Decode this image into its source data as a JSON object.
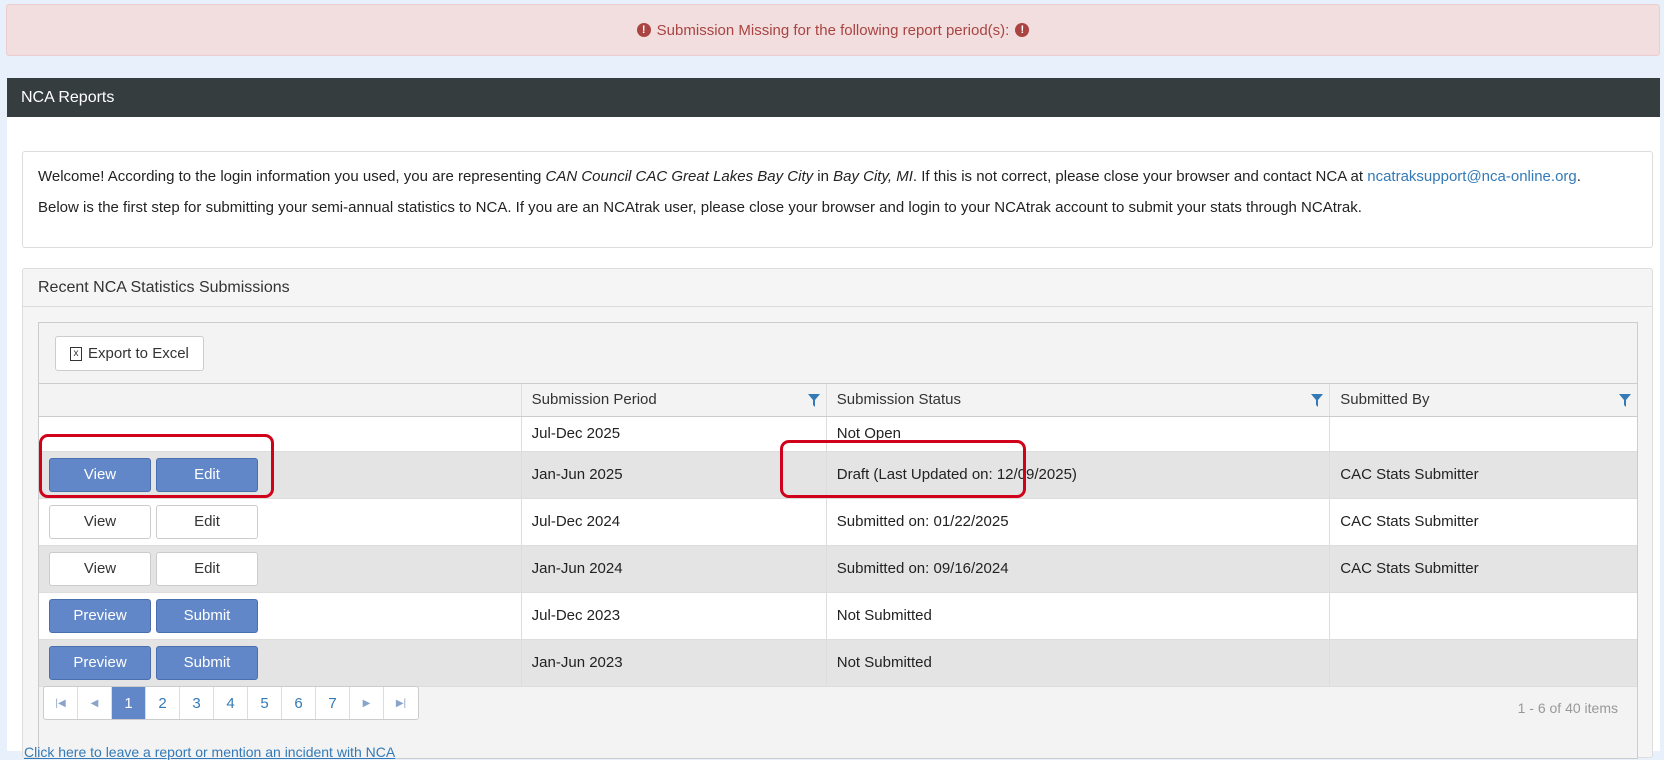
{
  "alert": {
    "text": "Submission Missing for the following report period(s):"
  },
  "panel": {
    "title": "NCA Reports"
  },
  "welcome": {
    "p1_a": "Welcome! According to the login information you used, you are representing ",
    "org": "CAN Council CAC Great Lakes Bay City",
    "p1_b": " in ",
    "city": "Bay City, MI",
    "p1_c": ". If this is not correct, please close your browser and contact NCA at ",
    "email": "ncatraksupport@nca-online.org",
    "p1_d": ".",
    "p2": "Below is the first step for submitting your semi-annual statistics to NCA. If you are an NCAtrak user, please close your browser and login to your NCAtrak account to submit your stats through NCAtrak."
  },
  "recent": {
    "title": "Recent NCA Statistics Submissions"
  },
  "toolbar": {
    "export_label": "Export to Excel"
  },
  "columns": [
    "",
    "Submission Period",
    "Submission Status",
    "Submitted By"
  ],
  "rows": [
    {
      "period": "Jul-Dec 2025",
      "status": "Not Open",
      "by": "",
      "actions": []
    },
    {
      "period": "Jan-Jun 2025",
      "status": "Draft (Last Updated on: 12/09/2025)",
      "by": "CAC Stats Submitter",
      "actions": [
        "View",
        "Edit"
      ],
      "style": "primary"
    },
    {
      "period": "Jul-Dec 2024",
      "status": "Submitted on: 01/22/2025",
      "by": "CAC Stats Submitter",
      "actions": [
        "View",
        "Edit"
      ],
      "style": "default"
    },
    {
      "period": "Jan-Jun 2024",
      "status": "Submitted on: 09/16/2024",
      "by": "CAC Stats Submitter",
      "actions": [
        "View",
        "Edit"
      ],
      "style": "default"
    },
    {
      "period": "Jul-Dec 2023",
      "status": "Not Submitted",
      "by": "",
      "actions": [
        "Preview",
        "Submit"
      ],
      "style": "primary"
    },
    {
      "period": "Jan-Jun 2023",
      "status": "Not Submitted",
      "by": "",
      "actions": [
        "Preview",
        "Submit"
      ],
      "style": "primary"
    }
  ],
  "pager": {
    "pages": [
      "1",
      "2",
      "3",
      "4",
      "5",
      "6",
      "7"
    ],
    "current": "1",
    "info": "1 - 6 of 40 items"
  },
  "bottom": {
    "link": "Click here to leave a report or mention an incident with NCA"
  },
  "colors": {
    "primary": "#6187c8",
    "header": "#363d3f",
    "alert_bg": "#f2dede",
    "highlight": "#d0021b"
  },
  "icons": {
    "alert": "exclamation-circle-icon",
    "filter": "filter-icon",
    "export": "excel-icon"
  }
}
